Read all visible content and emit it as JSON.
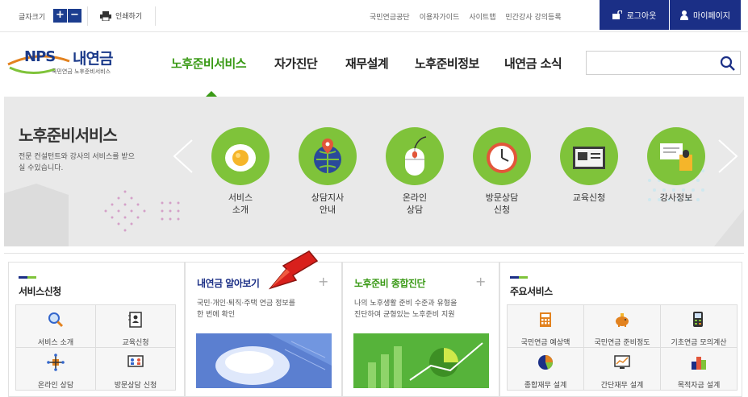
{
  "util": {
    "font_size_label": "글자크기",
    "plus": "+",
    "minus": "−",
    "print": "인쇄하기",
    "links": [
      "국민연금공단",
      "이용자가이드",
      "사이트맵",
      "민간강사 강의등록"
    ],
    "login": "로그아웃",
    "mypage": "마이페이지"
  },
  "logo": {
    "brand": "NPS",
    "name": "내연금",
    "subtitle": "국민연금 노후준비서비스"
  },
  "gnb": [
    "노후준비서비스",
    "자가진단",
    "재무설계",
    "노후준비정보",
    "내연금 소식"
  ],
  "band": {
    "title": "노후준비서비스",
    "desc": "전문 컨설턴트와 강사의 서비스를 받으실 수있습니다.",
    "services": [
      {
        "line1": "서비스",
        "line2": "소개",
        "icon": "egg-icon"
      },
      {
        "line1": "상담지사",
        "line2": "안내",
        "icon": "globe-pin-icon"
      },
      {
        "line1": "온라인",
        "line2": "상담",
        "icon": "mouse-icon"
      },
      {
        "line1": "방문상담",
        "line2": "신청",
        "icon": "clock-icon"
      },
      {
        "line1": "교육신청",
        "line2": "",
        "icon": "board-icon"
      },
      {
        "line1": "강사정보",
        "line2": "",
        "icon": "podium-icon"
      }
    ]
  },
  "col1": {
    "title": "서비스신청",
    "items": [
      "서비스 소개",
      "교육신청",
      "온라인 상담",
      "방문상담 신청"
    ]
  },
  "col2": {
    "title": "내연금 알아보기",
    "plus": "+",
    "desc1": "국민·개인·퇴직·주택 연금 정보를",
    "desc2": "한 번에 확인"
  },
  "col3": {
    "title": "노후준비 종합진단",
    "plus": "+",
    "desc1": "나의 노후생활 준비 수준과 유형을",
    "desc2": "진단하여 균형있는 노후준비 지원"
  },
  "col4": {
    "title": "주요서비스",
    "items": [
      "국민연금 예상액",
      "국민연금 준비정도",
      "기초연금 모의계산",
      "종합재무 설계",
      "간단재무 설계",
      "목적자금 설계"
    ]
  },
  "colors": {
    "navy": "#1b2f86",
    "green": "#3a9a16",
    "circle": "#7fc33a"
  }
}
